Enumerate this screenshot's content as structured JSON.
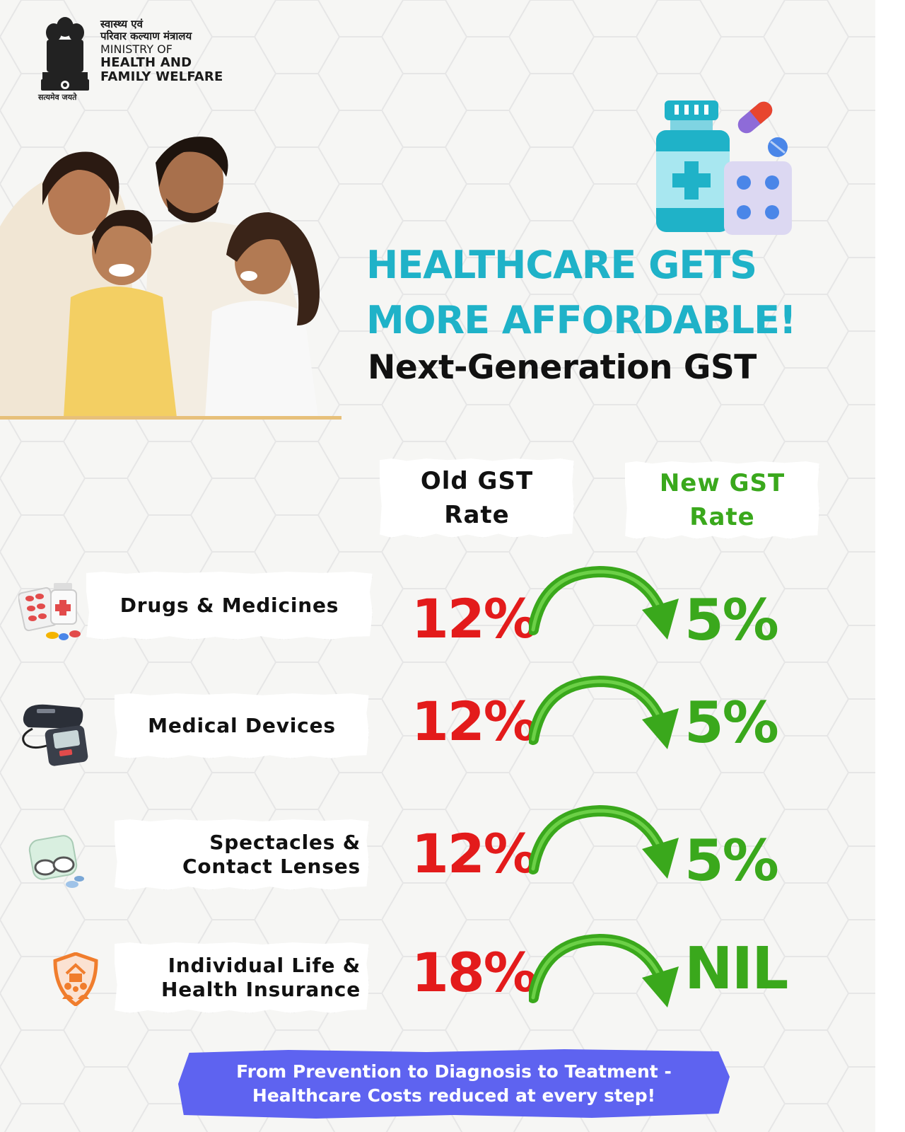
{
  "header": {
    "ministry_hindi_line1": "स्वास्थ्य एवं",
    "ministry_hindi_line2": "परिवार कल्याण मंत्रालय",
    "ministry_en_line1": "MINISTRY OF",
    "ministry_en_line2": "HEALTH AND",
    "ministry_en_line3": "FAMILY WELFARE",
    "motto": "सत्यमेव जयते"
  },
  "headline": {
    "line1": "HEALTHCARE GETS",
    "line2": "MORE AFFORDABLE!",
    "subtitle": "Next-Generation GST"
  },
  "columns": {
    "old_line1": "Old GST",
    "old_line2": "Rate",
    "new_line1": "New GST",
    "new_line2": "Rate"
  },
  "rows": [
    {
      "label_line1": "Drugs & Medicines",
      "label_line2": "",
      "old": "12%",
      "new": "5%",
      "icon": "medicine-pills-icon"
    },
    {
      "label_line1": "Medical Devices",
      "label_line2": "",
      "old": "12%",
      "new": "5%",
      "icon": "blood-pressure-monitor-icon"
    },
    {
      "label_line1": "Spectacles &",
      "label_line2": "Contact Lenses",
      "old": "12%",
      "new": "5%",
      "icon": "spectacles-lenses-icon"
    },
    {
      "label_line1": "Individual Life &",
      "label_line2": "Health Insurance",
      "old": "18%",
      "new": "NIL",
      "icon": "insurance-shield-icon"
    }
  ],
  "footer": {
    "line1": "From Prevention to Diagnosis to Teatment -",
    "line2": "Healthcare Costs reduced at every step!"
  },
  "colors": {
    "headline": "#1fb2c8",
    "old_rate": "#e31b1b",
    "new_rate": "#3aa81c",
    "footer_bg": "#5e63f0"
  }
}
